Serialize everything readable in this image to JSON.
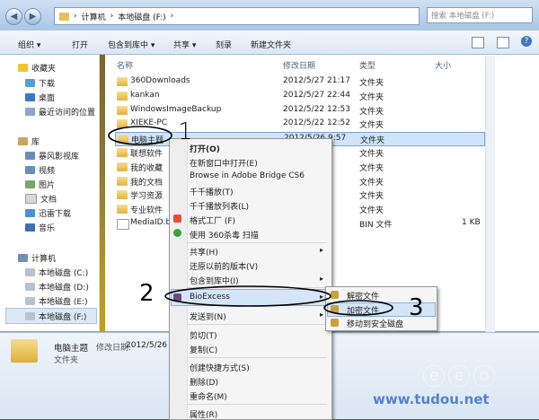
{
  "address": {
    "segments": [
      "计算机",
      "本地磁盘 (F:)"
    ],
    "search_placeholder": "搜索 本地磁盘 (F:)"
  },
  "toolbar": {
    "organize": "组织 ▾",
    "open": "打开",
    "include": "包含到库中 ▾",
    "share": "共享 ▾",
    "burn": "刻录",
    "new_folder": "新建文件夹"
  },
  "nav": {
    "favorites": "收藏夹",
    "downloads": "下载",
    "desktop": "桌面",
    "recent": "最近访问的位置",
    "libraries": "库",
    "videos_lib": "暴风影视库",
    "videos": "视频",
    "pictures": "图片",
    "documents": "文档",
    "thunder": "迅雷下载",
    "music": "音乐",
    "computer": "计算机",
    "drive_c": "本地磁盘 (C:)",
    "drive_d": "本地磁盘 (D:)",
    "drive_e": "本地磁盘 (E:)",
    "drive_f": "本地磁盘 (F:)"
  },
  "columns": {
    "name": "名称",
    "date": "修改日期",
    "type": "类型",
    "size": "大小"
  },
  "files": [
    {
      "name": "360Downloads",
      "date": "2012/5/27 21:17",
      "type": "文件夹",
      "size": ""
    },
    {
      "name": "kankan",
      "date": "2012/5/27 22:44",
      "type": "文件夹",
      "size": ""
    },
    {
      "name": "WindowsImageBackup",
      "date": "2012/5/22 12:53",
      "type": "文件夹",
      "size": ""
    },
    {
      "name": "XIEKE-PC",
      "date": "2012/5/22 12:52",
      "type": "文件夹",
      "size": ""
    },
    {
      "name": "电脑主题",
      "date": "2012/5/26 9:57",
      "type": "文件夹",
      "size": ""
    },
    {
      "name": "联想软件",
      "date": "43",
      "type": "文件夹",
      "size": ""
    },
    {
      "name": "我的收藏",
      "date": "33",
      "type": "文件夹",
      "size": ""
    },
    {
      "name": "我的文档",
      "date": "19",
      "type": "文件夹",
      "size": ""
    },
    {
      "name": "学习资源",
      "date": "55",
      "type": "文件夹",
      "size": ""
    },
    {
      "name": "专业软件",
      "date": "03",
      "type": "文件夹",
      "size": ""
    },
    {
      "name": "MediaID.bin",
      "date": "51",
      "type": "BIN 文件",
      "size": "1 KB"
    }
  ],
  "context_menu": {
    "open": "打开(O)",
    "open_new": "在新窗口中打开(E)",
    "bridge": "Browse in Adobe Bridge CS6",
    "qq_play": "千千播放(T)",
    "qq_list": "千千播放列表(L)",
    "format_factory": "格式工厂 (F)",
    "scan_360": "使用 360杀毒 扫描",
    "share": "共享(H)",
    "restore": "还原以前的版本(V)",
    "include": "包含到库中(I)",
    "bioexcess": "BioExcess",
    "send_to": "发送到(N)",
    "cut": "剪切(T)",
    "copy": "复制(C)",
    "shortcut": "创建快捷方式(S)",
    "delete": "删除(D)",
    "rename": "重命名(M)",
    "properties": "属性(R)"
  },
  "submenu": {
    "decrypt": "解密文件",
    "encrypt": "加密文件",
    "move_safe": "移动到安全磁盘"
  },
  "details": {
    "name": "电脑主题",
    "modified_label": "修改日期:",
    "modified": "2012/5/26",
    "type": "文件夹"
  },
  "annotations": {
    "n1": "1",
    "n2": "2",
    "n3": "3"
  },
  "watermark": {
    "main": "ⓔⓔⓞ",
    "url": "www.tudou.net"
  },
  "colors": {
    "accent": "#3a78c2",
    "selection": "#cfe4fb",
    "annotation": "#000000"
  }
}
